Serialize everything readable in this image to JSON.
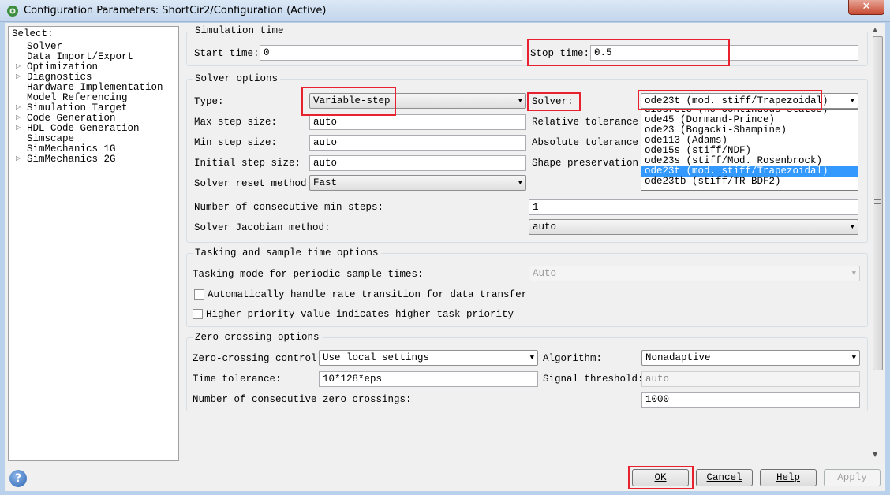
{
  "window": {
    "title": "Configuration Parameters: ShortCir2/Configuration (Active)",
    "close_label": "✕"
  },
  "tree": {
    "select_label": "Select:",
    "items": [
      {
        "label": "Solver",
        "expandable": false
      },
      {
        "label": "Data Import/Export",
        "expandable": false
      },
      {
        "label": "Optimization",
        "expandable": true
      },
      {
        "label": "Diagnostics",
        "expandable": true
      },
      {
        "label": "Hardware Implementation",
        "expandable": false
      },
      {
        "label": "Model Referencing",
        "expandable": false
      },
      {
        "label": "Simulation Target",
        "expandable": true
      },
      {
        "label": "Code Generation",
        "expandable": true
      },
      {
        "label": "HDL Code Generation",
        "expandable": true
      },
      {
        "label": "Simscape",
        "expandable": false
      },
      {
        "label": "SimMechanics 1G",
        "expandable": false
      },
      {
        "label": "SimMechanics 2G",
        "expandable": true
      }
    ]
  },
  "simulation_time": {
    "title": "Simulation time",
    "start_label": "Start time:",
    "start_value": "0",
    "stop_label": "Stop time:",
    "stop_value": "0.5"
  },
  "solver_options": {
    "title": "Solver options",
    "type_label": "Type:",
    "type_value": "Variable-step",
    "solver_label": "Solver:",
    "solver_value": "ode23t (mod. stiff/Trapezoidal)",
    "max_step_label": "Max step size:",
    "max_step_value": "auto",
    "min_step_label": "Min step size:",
    "min_step_value": "auto",
    "initial_step_label": "Initial step size:",
    "initial_step_value": "auto",
    "reset_label": "Solver reset method:",
    "reset_value": "Fast",
    "rel_tol_label": "Relative tolerance:",
    "abs_tol_label": "Absolute tolerance:",
    "shape_label": "Shape preservation:",
    "consec_min_label": "Number of consecutive min steps:",
    "consec_min_value": "1",
    "jacobian_label": "Solver Jacobian method:",
    "jacobian_value": "auto",
    "dropdown_options": [
      "discrete (no continuous states)",
      "ode45 (Dormand-Prince)",
      "ode23 (Bogacki-Shampine)",
      "ode113 (Adams)",
      "ode15s (stiff/NDF)",
      "ode23s (stiff/Mod. Rosenbrock)",
      "ode23t (mod. stiff/Trapezoidal)",
      "ode23tb (stiff/TR-BDF2)"
    ]
  },
  "tasking": {
    "title": "Tasking and sample time options",
    "mode_label": "Tasking mode for periodic sample times:",
    "mode_value": "Auto",
    "rate_transition_label": "Automatically handle rate transition for data transfer",
    "priority_label": "Higher priority value indicates higher task priority"
  },
  "zero_crossing": {
    "title": "Zero-crossing options",
    "control_label": "Zero-crossing control:",
    "control_value": "Use local settings",
    "algorithm_label": "Algorithm:",
    "algorithm_value": "Nonadaptive",
    "time_tol_label": "Time tolerance:",
    "time_tol_value": "10*128*eps",
    "signal_label": "Signal threshold:",
    "signal_value": "auto",
    "consec_label": "Number of consecutive zero crossings:",
    "consec_value": "1000"
  },
  "buttons": {
    "ok": "OK",
    "cancel": "Cancel",
    "help": "Help",
    "apply": "Apply"
  },
  "colors": {
    "highlight_box": "#e8212e",
    "selection": "#3399ff"
  }
}
